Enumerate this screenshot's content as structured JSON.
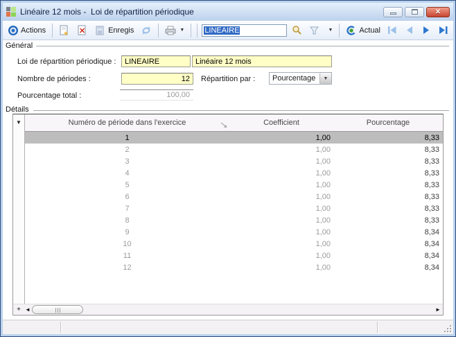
{
  "window": {
    "title": "Linéaire 12 mois -  Loi de répartition périodique"
  },
  "toolbar": {
    "actions_label": "Actions",
    "save_label": "Enregis",
    "search_value": "LINEAIRE",
    "actual_label": "Actual"
  },
  "icons": {
    "grid_menu": "▼",
    "dropdown_arrow": "▼",
    "close": "✕",
    "plus": "+",
    "scroll_left": "◄",
    "scroll_right": "►"
  },
  "general": {
    "section_label": "Général",
    "law_label": "Loi de répartition périodique :",
    "law_code": "LINEAIRE",
    "law_name": "Linéaire 12 mois",
    "periods_label": "Nombre de périodes :",
    "periods_value": "12",
    "repartition_label": "Répartition par :",
    "repartition_value": "Pourcentage",
    "total_label": "Pourcentage total :",
    "total_value": "100,00"
  },
  "details": {
    "section_label": "Détails",
    "columns": {
      "period": "Numéro de période dans l'exercice",
      "coefficient": "Coefficient",
      "percentage": "Pourcentage"
    },
    "selected_index": 0,
    "rows": [
      {
        "period": "1",
        "coefficient": "1,00",
        "percentage": "8,33"
      },
      {
        "period": "2",
        "coefficient": "1,00",
        "percentage": "8,33"
      },
      {
        "period": "3",
        "coefficient": "1,00",
        "percentage": "8,33"
      },
      {
        "period": "4",
        "coefficient": "1,00",
        "percentage": "8,33"
      },
      {
        "period": "5",
        "coefficient": "1,00",
        "percentage": "8,33"
      },
      {
        "period": "6",
        "coefficient": "1,00",
        "percentage": "8,33"
      },
      {
        "period": "7",
        "coefficient": "1,00",
        "percentage": "8,33"
      },
      {
        "period": "8",
        "coefficient": "1,00",
        "percentage": "8,33"
      },
      {
        "period": "9",
        "coefficient": "1,00",
        "percentage": "8,34"
      },
      {
        "period": "10",
        "coefficient": "1,00",
        "percentage": "8,34"
      },
      {
        "period": "11",
        "coefficient": "1,00",
        "percentage": "8,34"
      },
      {
        "period": "12",
        "coefficient": "1,00",
        "percentage": "8,34"
      }
    ]
  },
  "colors": {
    "field_yellow": "#ffffc6",
    "selection_blue": "#316ac5",
    "selected_row_gray": "#bdbdbd",
    "titlebar_blue": "#bcd1ec",
    "close_red": "#c74530"
  }
}
